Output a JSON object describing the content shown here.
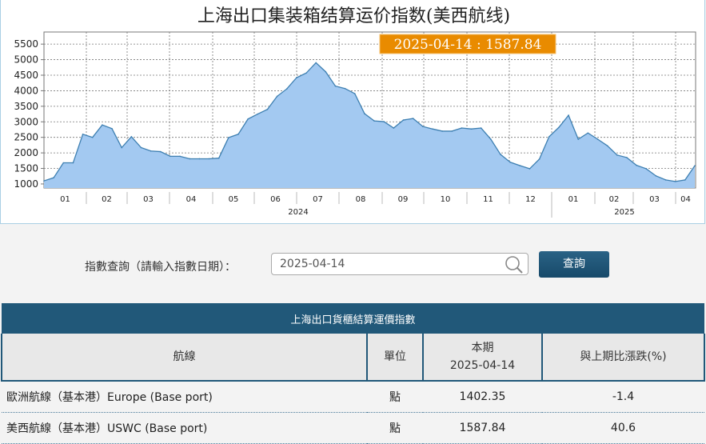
{
  "chart_data": {
    "type": "area",
    "title": "上海出口集装箱结算运价指数(美西航线)",
    "tooltip": "2025-04-14 : 1587.84",
    "y_ticks": [
      1000,
      1500,
      2000,
      2500,
      3000,
      3500,
      4000,
      4500,
      5000,
      5500
    ],
    "ylim": [
      870,
      5890
    ],
    "month_labels": [
      "01",
      "02",
      "03",
      "04",
      "05",
      "06",
      "07",
      "08",
      "09",
      "10",
      "11",
      "12",
      "01",
      "02",
      "03",
      "04"
    ],
    "year_labels": [
      "2024",
      "2025"
    ],
    "grid": true,
    "values": [
      1100,
      1200,
      1680,
      1680,
      2600,
      2500,
      2900,
      2780,
      2170,
      2520,
      2170,
      2060,
      2040,
      1890,
      1890,
      1810,
      1810,
      1810,
      1830,
      2490,
      2600,
      3090,
      3250,
      3400,
      3820,
      4060,
      4420,
      4570,
      4900,
      4610,
      4150,
      4070,
      3905,
      3262,
      3030,
      3005,
      2800,
      3057,
      3108,
      2850,
      2770,
      2700,
      2700,
      2800,
      2770,
      2800,
      2440,
      1950,
      1700,
      1590,
      1490,
      1800,
      2520,
      2820,
      3210,
      2440,
      2640,
      2440,
      2230,
      1930,
      1850,
      1600,
      1490,
      1260,
      1130,
      1080,
      1130,
      1587.84
    ],
    "fill_color": "#a3c9f1",
    "line_color": "#3d7fb1",
    "tooltip_color": "#e98b00"
  },
  "query": {
    "label": "指數查詢（請輸入指數日期）：",
    "date_value": "2025-04-14",
    "button": "查詢"
  },
  "table": {
    "caption": "上海出口貨櫃結算運價指數",
    "headers": {
      "route": "航線",
      "unit": "單位",
      "current": "本期",
      "current_date": "2025-04-14",
      "change": "與上期比漲跌(%)"
    },
    "rows": [
      {
        "route": "歐洲航線（基本港）Europe (Base port)",
        "unit": "點",
        "value": "1402.35",
        "change": "-1.4"
      },
      {
        "route": "美西航線（基本港）USWC (Base port)",
        "unit": "點",
        "value": "1587.84",
        "change": "40.6"
      }
    ]
  }
}
